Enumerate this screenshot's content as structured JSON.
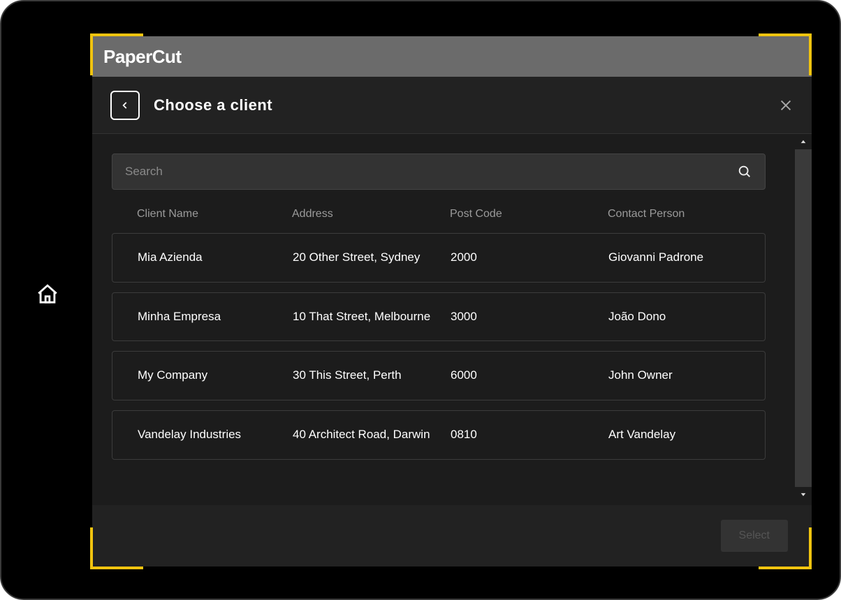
{
  "app": {
    "title": "PaperCut"
  },
  "modal": {
    "title": "Choose a client",
    "search_placeholder": "Search",
    "select_label": "Select"
  },
  "columns": {
    "name": "Client Name",
    "address": "Address",
    "postcode": "Post Code",
    "contact": "Contact Person"
  },
  "clients": [
    {
      "name": "Mia Azienda",
      "address": "20 Other Street, Sydney",
      "postcode": "2000",
      "contact": "Giovanni Padrone"
    },
    {
      "name": "Minha Empresa",
      "address": "10 That Street, Melbourne",
      "postcode": "3000",
      "contact": "João Dono"
    },
    {
      "name": "My Company",
      "address": "30 This Street, Perth",
      "postcode": "6000",
      "contact": "John Owner"
    },
    {
      "name": "Vandelay Industries",
      "address": "40 Architect Road, Darwin",
      "postcode": "0810",
      "contact": "Art Vandelay"
    }
  ]
}
